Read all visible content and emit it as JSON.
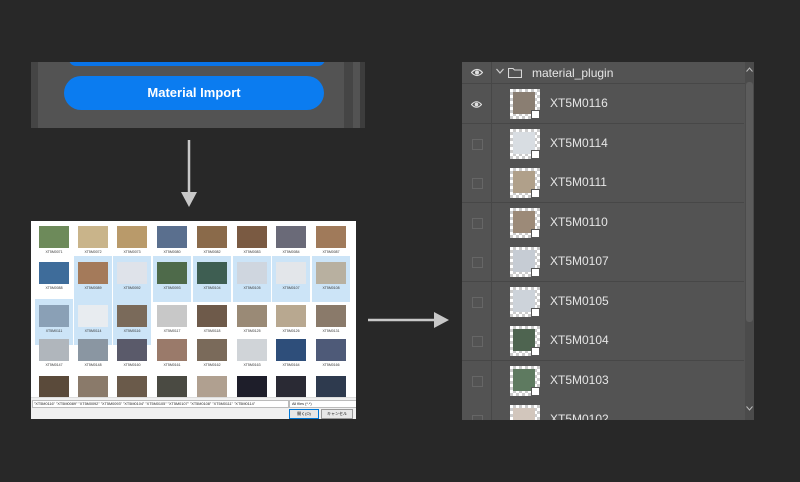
{
  "plugin": {
    "import_button": "Material Import"
  },
  "file_dialog": {
    "rows": [
      {
        "captions": [
          "XT5M0071",
          "XT5M0072",
          "XT5M0073",
          "XT5M0080",
          "XT5M0082",
          "XT5M0083",
          "XT5M0084",
          "XT5M0087"
        ],
        "colors": [
          "#6d8a5a",
          "#c9b48a",
          "#b99a6a",
          "#5a6f8e",
          "#8a6a4a",
          "#7a5a42",
          "#6a6a78",
          "#a07a5a"
        ],
        "selected": [
          false,
          false,
          false,
          false,
          false,
          false,
          false,
          false
        ]
      },
      {
        "captions": [
          "XT5M0088",
          "XT5M0089",
          "XT5M0092",
          "XT5M0093",
          "XT5M0104",
          "XT5M0105",
          "XT5M0107",
          "XT5M0108"
        ],
        "colors": [
          "#3e6c9a",
          "#a47a5a",
          "#dfe3ea",
          "#4e6a4a",
          "#3e5e52",
          "#cfd6df",
          "#e3e6ea",
          "#b8b0a0"
        ],
        "selected": [
          false,
          true,
          true,
          true,
          true,
          true,
          true,
          true
        ]
      },
      {
        "captions": [
          "XT5M0111",
          "XT5M0114",
          "XT5M0116",
          "XT5M0117",
          "XT5M0118",
          "XT5M0125",
          "XT5M0126",
          "XT5M0131"
        ],
        "colors": [
          "#8aa0b6",
          "#e8ecf0",
          "#7a6a5a",
          "#c8c8c8",
          "#6e5a4a",
          "#9a8a76",
          "#b8a890",
          "#8a7a6a"
        ],
        "selected": [
          true,
          true,
          true,
          false,
          false,
          false,
          false,
          false
        ]
      },
      {
        "captions": [
          "XT5M0147",
          "XT5M0148",
          "XT5M0160",
          "XT5M0161",
          "XT5M0162",
          "XT5M0163",
          "XT5M0164",
          "XT5M0166"
        ],
        "colors": [
          "#b0b6bc",
          "#8a96a2",
          "#5a5a6a",
          "#9a7a6a",
          "#7a6a5a",
          "#d0d4d8",
          "#2e4e7a",
          "#4e5a78"
        ],
        "selected": [
          false,
          false,
          false,
          false,
          false,
          false,
          false,
          false
        ]
      },
      {
        "captions": [
          "",
          "",
          "",
          "",
          "",
          "",
          "",
          ""
        ],
        "colors": [
          "#5a4a3a",
          "#8a7a6a",
          "#6a5a4a",
          "#4a4a42",
          "#b0a090",
          "#1e1e2a",
          "#2a2a34",
          "#2e3a4e"
        ],
        "selected": [
          false,
          false,
          false,
          false,
          false,
          false,
          false,
          false
        ]
      }
    ],
    "filename_value": "\"XT5M0116\" \"XT5M0089\" \"XT5M0092\" \"XT5M0093\" \"XT5M0104\" \"XT5M0105\" \"XT5M0107\" \"XT5M0108\" \"XT5M0111\" \"XT5M0114\"",
    "filetype_value": "All files (*.*)",
    "open_button": "開く(O)",
    "cancel_button": "キャンセル"
  },
  "layers": {
    "group_name": "material_plugin",
    "items": [
      {
        "name": "XT5M0116",
        "visible": true,
        "color": "#8a7e72"
      },
      {
        "name": "XT5M0114",
        "visible": false,
        "color": "#d8dde2"
      },
      {
        "name": "XT5M0111",
        "visible": false,
        "color": "#b0a08a"
      },
      {
        "name": "XT5M0110",
        "visible": false,
        "color": "#9c8a78"
      },
      {
        "name": "XT5M0107",
        "visible": false,
        "color": "#c6ccd4"
      },
      {
        "name": "XT5M0105",
        "visible": false,
        "color": "#cdd3da"
      },
      {
        "name": "XT5M0104",
        "visible": false,
        "color": "#4e6450"
      },
      {
        "name": "XT5M0103",
        "visible": false,
        "color": "#5e7a60"
      },
      {
        "name": "XT5M0102",
        "visible": false,
        "color": "#d2c6bc"
      }
    ]
  },
  "colors": {
    "background": "#282828",
    "panel": "#535353",
    "accent_blue": "#0b7cf0",
    "selection": "#cce4f7",
    "layer_text": "#e6e6e6"
  }
}
